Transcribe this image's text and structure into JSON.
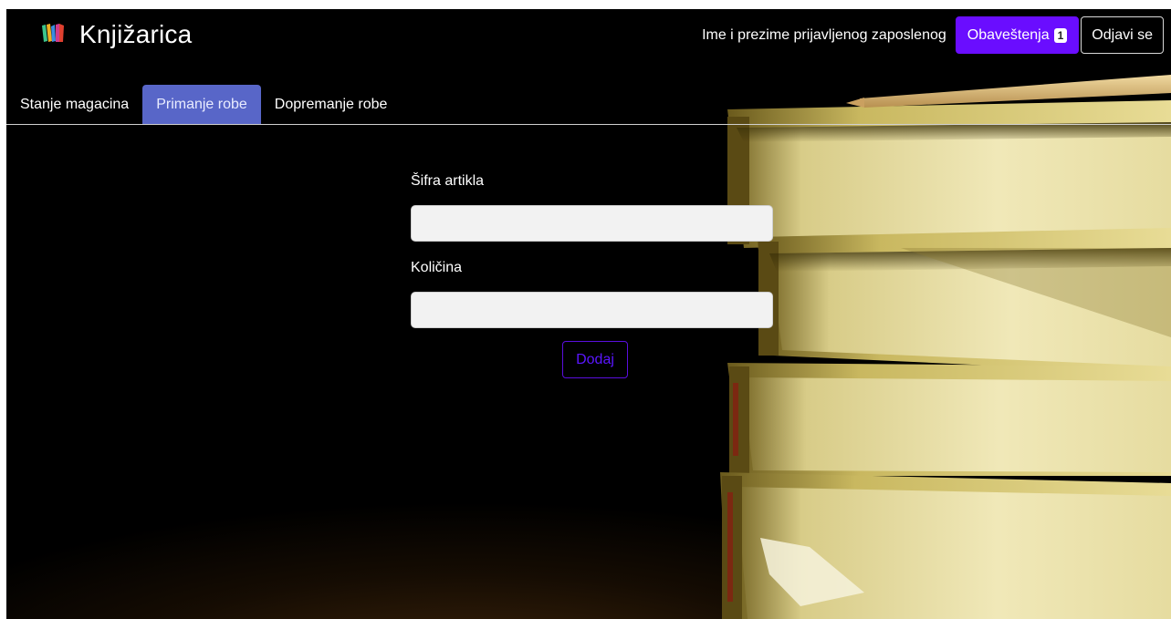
{
  "app": {
    "title": "Knjižarica",
    "logo_icon": "books-logo-icon"
  },
  "header": {
    "user_name": "Ime i prezime prijavljenog zaposlenog",
    "notifications_label": "Obaveštenja",
    "notifications_count": "1",
    "logout_label": "Odjavi se"
  },
  "tabs": [
    {
      "label": "Stanje magacina",
      "active": false
    },
    {
      "label": "Primanje robe",
      "active": true
    },
    {
      "label": "Dopremanje robe",
      "active": false
    }
  ],
  "form": {
    "article_code_label": "Šifra artikla",
    "article_code_value": "",
    "quantity_label": "Količina",
    "quantity_value": "",
    "submit_label": "Dodaj"
  },
  "colors": {
    "accent": "#6a0dff",
    "active_tab": "#5866c8",
    "background": "#000000"
  }
}
